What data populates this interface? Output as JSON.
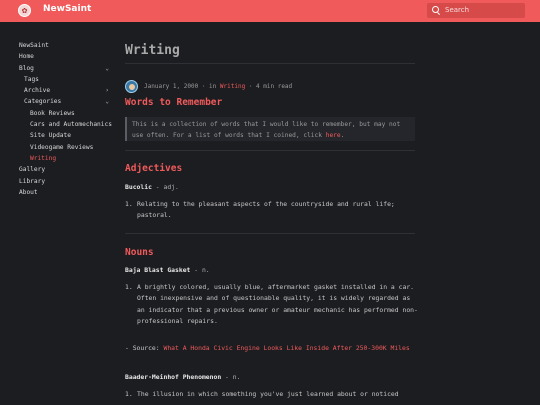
{
  "header": {
    "brand": "NewSaint",
    "logo_glyph": "✿",
    "search_placeholder": "Search"
  },
  "sidebar": {
    "items": [
      {
        "label": "NewSaint"
      },
      {
        "label": "Home"
      },
      {
        "label": "Blog",
        "chevron": "⌄"
      },
      {
        "label": "Tags"
      },
      {
        "label": "Archive",
        "chevron": "›"
      },
      {
        "label": "Categories",
        "chevron": "⌄"
      },
      {
        "label": "Book Reviews"
      },
      {
        "label": "Cars and Automechanics"
      },
      {
        "label": "Site Update"
      },
      {
        "label": "Videogame Reviews"
      },
      {
        "label": "Writing"
      },
      {
        "label": "Gallery"
      },
      {
        "label": "Library"
      },
      {
        "label": "About"
      }
    ]
  },
  "post": {
    "page_title": "Writing",
    "date": "January 1, 2000",
    "in_label": "· in",
    "category": "Writing",
    "read_time": "· 4 min read",
    "heading": "Words to Remember",
    "intro": "This is a collection of words that I would like to remember, but may not use often. For a list of words that I coined, click",
    "intro_link": "here",
    "intro_end": "."
  },
  "sections": {
    "adjectives": {
      "title": "Adjectives",
      "term": "Bucolic",
      "pos": " - adj.",
      "def_num": "1.",
      "definition": "Relating to the pleasant aspects of the countryside and rural life; pastoral."
    },
    "nouns": {
      "title": "Nouns",
      "term1": "Baja Blast Gasket",
      "pos1": " - n.",
      "def1_num": "1.",
      "definition1": "A brightly colored, usually blue, aftermarket gasket installed in a car. Often inexpensive and of questionable quality, it is widely regarded as an indicator that a previous owner or amateur mechanic has performed non-professional repairs.",
      "source_label": "- Source: ",
      "source_link": "What A Honda Civic Engine Looks Like Inside After 250-300K Miles",
      "term2": "Baader-Meinhof Phenomenon",
      "pos2": " - n.",
      "def2_num": "1.",
      "definition2": "The illusion in which something you've just learned about or noticed"
    }
  },
  "colors": {
    "accent": "#f05a5a",
    "background": "#1c1d21"
  }
}
